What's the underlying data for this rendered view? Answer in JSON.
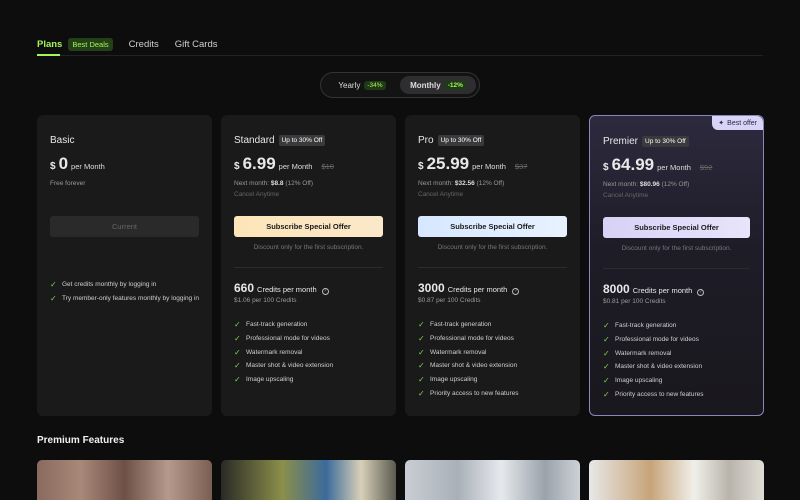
{
  "tabs": [
    {
      "label": "Plans",
      "badge": "Best Deals"
    },
    {
      "label": "Credits"
    },
    {
      "label": "Gift Cards"
    }
  ],
  "billing_toggle": {
    "yearly": {
      "label": "Yearly",
      "discount": "-34%"
    },
    "monthly": {
      "label": "Monthly",
      "discount": "-12%"
    },
    "selected": "Monthly"
  },
  "plans": [
    {
      "name": "Basic",
      "currency": "$",
      "price": "0",
      "per": "per Month",
      "note": "Free forever",
      "cta": "Current",
      "features": [
        "Get credits monthly by logging in",
        "Try member-only features monthly by logging in"
      ]
    },
    {
      "name": "Standard",
      "badge": "Up to 30% Off",
      "currency": "$",
      "price": "6.99",
      "per": "per Month",
      "original": "$10",
      "next_month_label": "Next month:",
      "next_month_price": "$8.8",
      "next_month_off": "(12% Off)",
      "cancel": "Cancel Anytime",
      "cta": "Subscribe Special Offer",
      "discount_note": "Discount only for the first subscription.",
      "credits": "660",
      "credits_label": "Credits per month",
      "credits_rate": "$1.06 per 100 Credits",
      "features": [
        "Fast-track generation",
        "Professional mode for videos",
        "Watermark removal",
        "Master shot & video extension",
        "Image upscaling"
      ]
    },
    {
      "name": "Pro",
      "badge": "Up to 30% Off",
      "currency": "$",
      "price": "25.99",
      "per": "per Month",
      "original": "$37",
      "next_month_label": "Next month:",
      "next_month_price": "$32.56",
      "next_month_off": "(12% Off)",
      "cancel": "Cancel Anytime",
      "cta": "Subscribe Special Offer",
      "discount_note": "Discount only for the first subscription.",
      "credits": "3000",
      "credits_label": "Credits per month",
      "credits_rate": "$0.87 per 100 Credits",
      "features": [
        "Fast-track generation",
        "Professional mode for videos",
        "Watermark removal",
        "Master shot & video extension",
        "Image upscaling",
        "Priority access to new features"
      ]
    },
    {
      "name": "Premier",
      "badge": "Up to 30% Off",
      "currency": "$",
      "price": "64.99",
      "per": "per Month",
      "original": "$92",
      "next_month_label": "Next month:",
      "next_month_price": "$80.96",
      "next_month_off": "(12% Off)",
      "cancel": "Cancel Anytime",
      "ribbon": "Best offer",
      "cta": "Subscribe Special Offer",
      "discount_note": "Discount only for the first subscription.",
      "credits": "8000",
      "credits_label": "Credits per month",
      "credits_rate": "$0.81 per 100 Credits",
      "features": [
        "Fast-track generation",
        "Professional mode for videos",
        "Watermark removal",
        "Master shot & video extension",
        "Image upscaling",
        "Priority access to new features"
      ]
    }
  ],
  "premium_features": {
    "title": "Premium Features"
  },
  "colors": {
    "accent": "#a6f35a",
    "background": "#0d0d0e",
    "card": "#1a1a1b",
    "premium_border": "#8b84bd"
  }
}
